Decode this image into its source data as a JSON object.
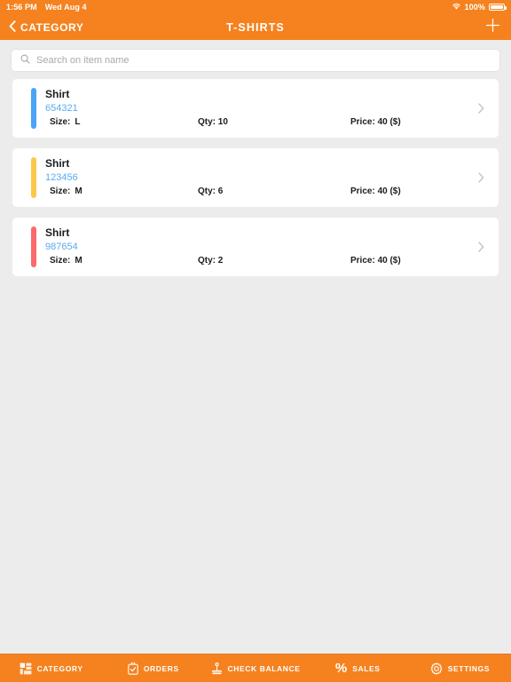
{
  "statusbar": {
    "time": "1:56 PM",
    "date": "Wed Aug 4",
    "battery_percent": "100%",
    "wifi_icon": "wifi-icon",
    "battery_icon": "battery-full-icon"
  },
  "navbar": {
    "back_label": "CATEGORY",
    "back_icon": "chevron-left-icon",
    "title": "T-SHIRTS",
    "add_icon": "plus-icon"
  },
  "search": {
    "placeholder": "Search on item name",
    "value": "",
    "icon": "search-icon"
  },
  "colors": {
    "brand_orange": "#F5821F",
    "page_background": "#ECECEC",
    "card_background": "#FFFFFF",
    "sku_blue": "#5AAAF0",
    "accent_blue": "#4BA3F5",
    "accent_yellow": "#FBC84B",
    "accent_red": "#FB6B6B"
  },
  "items": [
    {
      "name": "Shirt",
      "sku": "654321",
      "size_label": "Size:",
      "size_value": "L",
      "qty": "Qty: 10",
      "price": "Price: 40 ($)",
      "accent_color": "#4BA3F5",
      "chevron_icon": "chevron-right-icon"
    },
    {
      "name": "Shirt",
      "sku": "123456",
      "size_label": "Size:",
      "size_value": "M",
      "qty": "Qty: 6",
      "price": "Price: 40 ($)",
      "accent_color": "#FBC84B",
      "chevron_icon": "chevron-right-icon"
    },
    {
      "name": "Shirt",
      "sku": "987654",
      "size_label": "Size:",
      "size_value": "M",
      "qty": "Qty: 2",
      "price": "Price: 40 ($)",
      "accent_color": "#FB6B6B",
      "chevron_icon": "chevron-right-icon"
    }
  ],
  "tabbar": {
    "tabs": [
      {
        "label": "CATEGORY",
        "icon": "grid-blocks-icon"
      },
      {
        "label": "ORDERS",
        "icon": "clipboard-check-icon"
      },
      {
        "label": "CHECK BALANCE",
        "icon": "balance-scale-icon"
      },
      {
        "label": "SALES",
        "icon": "percent-icon"
      },
      {
        "label": "SETTINGS",
        "icon": "gear-icon"
      }
    ]
  }
}
